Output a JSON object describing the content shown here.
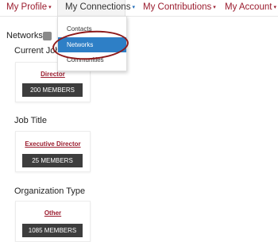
{
  "nav": {
    "profile": "My Profile",
    "connections": "My Connections",
    "contributions": "My Contributions",
    "account": "My Account",
    "caret": "▾"
  },
  "dropdown": {
    "items": [
      {
        "label": "Contacts"
      },
      {
        "label": "Networks",
        "selected": true
      },
      {
        "label": "Communities"
      }
    ]
  },
  "content": {
    "heading": "Networks",
    "icon": "info-icon",
    "sections": [
      {
        "title": "Current Job",
        "link": "Director",
        "badge": "200 MEMBERS"
      },
      {
        "title": "Job Title",
        "link": "Executive Director",
        "badge": "25 MEMBERS"
      },
      {
        "title": "Organization Type",
        "link": "Other",
        "badge": "1085 MEMBERS"
      }
    ]
  },
  "colors": {
    "brand": "#9b1c2e",
    "selected_item": "#2e7fc6",
    "badge": "#3d3d3d",
    "annotation": "#8e1a1a"
  }
}
